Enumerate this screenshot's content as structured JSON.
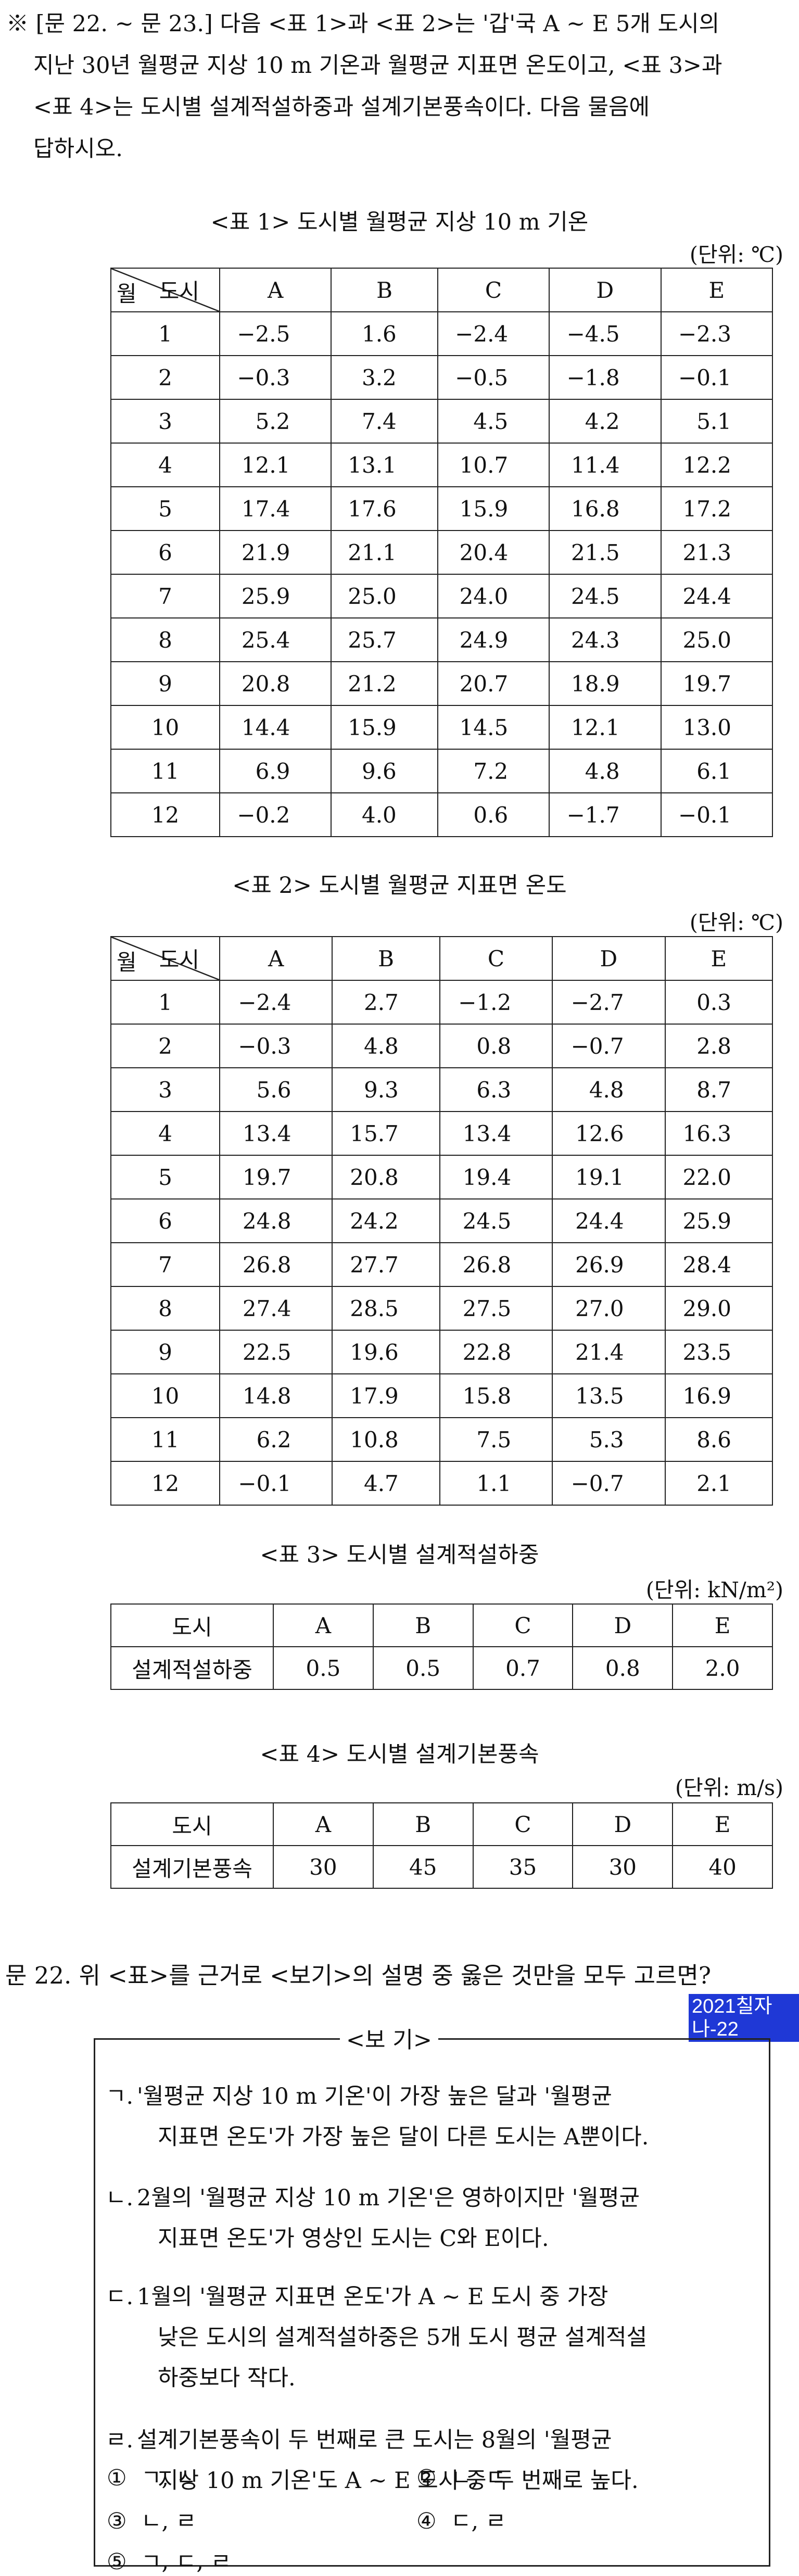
{
  "intro": [
    "※ [문 22. ~ 문 23.] 다음 <표 1>과 <표 2>는 '갑'국 A ~ E 5개 도시의",
    "지난 30년 월평균 지상 10 m 기온과 월평균 지표면 온도이고, <표 3>과",
    "<표 4>는 도시별 설계적설하중과 설계기본풍속이다. 다음 물음에",
    "답하시오."
  ],
  "table1": {
    "caption": "<표 1> 도시별 월평균 지상 10 m 기온",
    "unit": "(단위: ℃)",
    "corner_city": "도시",
    "corner_month": "월",
    "cities": [
      "A",
      "B",
      "C",
      "D",
      "E"
    ],
    "rows": [
      {
        "month": "1",
        "values": [
          "−2.5",
          "1.6",
          "−2.4",
          "−4.5",
          "−2.3"
        ]
      },
      {
        "month": "2",
        "values": [
          "−0.3",
          "3.2",
          "−0.5",
          "−1.8",
          "−0.1"
        ]
      },
      {
        "month": "3",
        "values": [
          "5.2",
          "7.4",
          "4.5",
          "4.2",
          "5.1"
        ]
      },
      {
        "month": "4",
        "values": [
          "12.1",
          "13.1",
          "10.7",
          "11.4",
          "12.2"
        ]
      },
      {
        "month": "5",
        "values": [
          "17.4",
          "17.6",
          "15.9",
          "16.8",
          "17.2"
        ]
      },
      {
        "month": "6",
        "values": [
          "21.9",
          "21.1",
          "20.4",
          "21.5",
          "21.3"
        ]
      },
      {
        "month": "7",
        "values": [
          "25.9",
          "25.0",
          "24.0",
          "24.5",
          "24.4"
        ]
      },
      {
        "month": "8",
        "values": [
          "25.4",
          "25.7",
          "24.9",
          "24.3",
          "25.0"
        ]
      },
      {
        "month": "9",
        "values": [
          "20.8",
          "21.2",
          "20.7",
          "18.9",
          "19.7"
        ]
      },
      {
        "month": "10",
        "values": [
          "14.4",
          "15.9",
          "14.5",
          "12.1",
          "13.0"
        ]
      },
      {
        "month": "11",
        "values": [
          "6.9",
          "9.6",
          "7.2",
          "4.8",
          "6.1"
        ]
      },
      {
        "month": "12",
        "values": [
          "−0.2",
          "4.0",
          "0.6",
          "−1.7",
          "−0.1"
        ]
      }
    ]
  },
  "table2": {
    "caption": "<표 2> 도시별 월평균 지표면 온도",
    "unit": "(단위: ℃)",
    "corner_city": "도시",
    "corner_month": "월",
    "cities": [
      "A",
      "B",
      "C",
      "D",
      "E"
    ],
    "rows": [
      {
        "month": "1",
        "values": [
          "−2.4",
          "2.7",
          "−1.2",
          "−2.7",
          "0.3"
        ]
      },
      {
        "month": "2",
        "values": [
          "−0.3",
          "4.8",
          "0.8",
          "−0.7",
          "2.8"
        ]
      },
      {
        "month": "3",
        "values": [
          "5.6",
          "9.3",
          "6.3",
          "4.8",
          "8.7"
        ]
      },
      {
        "month": "4",
        "values": [
          "13.4",
          "15.7",
          "13.4",
          "12.6",
          "16.3"
        ]
      },
      {
        "month": "5",
        "values": [
          "19.7",
          "20.8",
          "19.4",
          "19.1",
          "22.0"
        ]
      },
      {
        "month": "6",
        "values": [
          "24.8",
          "24.2",
          "24.5",
          "24.4",
          "25.9"
        ]
      },
      {
        "month": "7",
        "values": [
          "26.8",
          "27.7",
          "26.8",
          "26.9",
          "28.4"
        ]
      },
      {
        "month": "8",
        "values": [
          "27.4",
          "28.5",
          "27.5",
          "27.0",
          "29.0"
        ]
      },
      {
        "month": "9",
        "values": [
          "22.5",
          "19.6",
          "22.8",
          "21.4",
          "23.5"
        ]
      },
      {
        "month": "10",
        "values": [
          "14.8",
          "17.9",
          "15.8",
          "13.5",
          "16.9"
        ]
      },
      {
        "month": "11",
        "values": [
          "6.2",
          "10.8",
          "7.5",
          "5.3",
          "8.6"
        ]
      },
      {
        "month": "12",
        "values": [
          "−0.1",
          "4.7",
          "1.1",
          "−0.7",
          "2.1"
        ]
      }
    ]
  },
  "table3": {
    "caption": "<표 3> 도시별 설계적설하중",
    "unit": "(단위: kN/m²)",
    "header_label": "도시",
    "cities": [
      "A",
      "B",
      "C",
      "D",
      "E"
    ],
    "row_label": "설계적설하중",
    "values": [
      "0.5",
      "0.5",
      "0.7",
      "0.8",
      "2.0"
    ]
  },
  "table4": {
    "caption": "<표 4> 도시별 설계기본풍속",
    "unit": "(단위: m/s)",
    "header_label": "도시",
    "cities": [
      "A",
      "B",
      "C",
      "D",
      "E"
    ],
    "row_label": "설계기본풍속",
    "values": [
      "30",
      "45",
      "35",
      "30",
      "40"
    ]
  },
  "question": {
    "text": "문 22. 위 <표>를 근거로 <보기>의 설명 중 옳은 것만을 모두 고르면?",
    "tag": "2021칠자나-22"
  },
  "bogi": {
    "title": "<보 기>",
    "items": [
      {
        "marker": "ㄱ.",
        "lines": [
          "'월평균 지상 10 m 기온'이 가장 높은 달과 '월평균",
          "지표면 온도'가 가장 높은 달이 다른 도시는 A뿐이다."
        ]
      },
      {
        "marker": "ㄴ.",
        "lines": [
          "2월의 '월평균 지상 10 m 기온'은 영하이지만 '월평균",
          "지표면 온도'가 영상인 도시는 C와 E이다."
        ]
      },
      {
        "marker": "ㄷ.",
        "lines": [
          "1월의 '월평균 지표면 온도'가 A ~ E 도시 중 가장",
          "낮은 도시의 설계적설하중은 5개 도시 평균 설계적설",
          "하중보다 작다."
        ]
      },
      {
        "marker": "ㄹ.",
        "lines": [
          "설계기본풍속이 두 번째로 큰 도시는 8월의 '월평균",
          "지상 10 m 기온'도 A ~ E 도시 중 두 번째로 높다."
        ]
      }
    ]
  },
  "choices": [
    {
      "num": "①",
      "text": "ㄱ, ㄴ"
    },
    {
      "num": "②",
      "text": "ㄴ, ㄷ"
    },
    {
      "num": "③",
      "text": "ㄴ, ㄹ"
    },
    {
      "num": "④",
      "text": "ㄷ, ㄹ"
    },
    {
      "num": "⑤",
      "text": "ㄱ, ㄷ, ㄹ"
    }
  ]
}
